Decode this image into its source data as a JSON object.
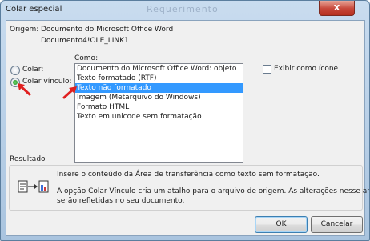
{
  "window": {
    "title": "Colar especial",
    "background_title": "Requerimento",
    "close_glyph": "x"
  },
  "source": {
    "label": "Origem:",
    "line1": "Documento do Microsoft Office Word",
    "line2": "Documento4!OLE_LINK1"
  },
  "as_label": "Como:",
  "paste_options": [
    {
      "label": "Colar:",
      "selected": false
    },
    {
      "label": "Colar vínculo:",
      "selected": true
    }
  ],
  "list_items": [
    "Documento do Microsoft Office Word: objeto",
    "Texto formatado (RTF)",
    "Texto não formatado",
    "Imagem (Metarquivo do Windows)",
    "Formato HTML",
    "Texto em unicode sem formatação"
  ],
  "selected_list_item": "Texto não formatado",
  "display_as_icon": {
    "label": "Exibir como ícone",
    "checked": false
  },
  "result": {
    "label": "Resultado",
    "line1": "Insere o conteúdo da Área de transferência como texto sem formatação.",
    "line2": "A opção Colar Vínculo cria um atalho para o arquivo de origem. As alterações nesse arquivo",
    "line3": "serão refletidas no seu documento."
  },
  "buttons": {
    "ok": "OK",
    "cancel": "Cancelar"
  },
  "colors": {
    "selection": "#3399ff",
    "annotation_arrow": "#e02020",
    "close": "#c7473a"
  },
  "icons": [
    "close-icon",
    "paste-link-result-icon",
    "annotation-arrow-icon"
  ]
}
